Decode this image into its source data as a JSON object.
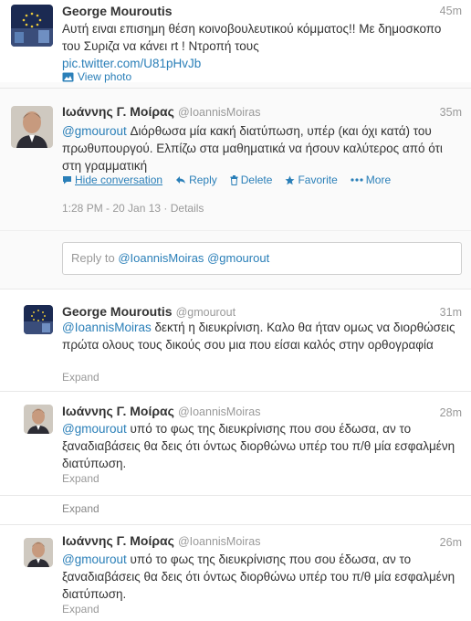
{
  "tweets": [
    {
      "name": "George Mouroutis",
      "handle": "",
      "time": "45m",
      "text": "Αυτή ειναι επισημη θέση κοινοβουλευτικού κόμματος!! Με δημοσκοπο του Συριζα να κάνει rt ! Ντροπή τους",
      "link": "pic.twitter.com/U81pHvJb",
      "view_photo": "View photo"
    },
    {
      "name": "Ιωάννης Γ. Μοίρας",
      "handle": "@IoannisMoiras",
      "time": "35m",
      "mention": "@gmourout",
      "text": " Διόρθωσα μία κακή διατύπωση, υπέρ (και όχι κατά) του πρωθυπουργού. Ελπίζω στα μαθηματικά να ήσουν καλύτερος από ότι στη γραμματική",
      "actions": {
        "hide": "Hide conversation",
        "reply": "Reply",
        "delete": "Delete",
        "favorite": "Favorite",
        "more": "More"
      },
      "timestamp": "1:28 PM - 20 Jan 13",
      "details": "Details"
    }
  ],
  "reply_box": {
    "prefix": "Reply to ",
    "mention1": "@IoannisMoiras",
    "mention2": "@gmourout"
  },
  "replies": [
    {
      "name": "George Mouroutis",
      "handle": "@gmourout",
      "time": "31m",
      "mention": "@IoannisMoiras",
      "text": " δεκτή η διευκρίνιση. Καλο θα ήταν ομως να διορθώσεις πρώτα ολους τους δικούς σου μια που είσαι καλός στην ορθογραφία",
      "expand": "Expand"
    },
    {
      "name": "Ιωάννης Γ. Μοίρας",
      "handle": "@IoannisMoiras",
      "time": "28m",
      "mention": "@gmourout",
      "text": " υπό το φως της διευκρίνισης που σου έδωσα, αν το ξαναδιαβάσεις θα δεις ότι όντως διορθώνω υπέρ του π/θ μία εσφαλμένη διατύπωση.",
      "expand": "Expand"
    },
    {
      "expand_only": "Expand"
    },
    {
      "name": "Ιωάννης Γ. Μοίρας",
      "handle": "@IoannisMoiras",
      "time": "26m",
      "mention": "@gmourout",
      "text": " υπό το φως της διευκρίνισης που σου έδωσα, αν το ξαναδιαβάσεις θα δεις ότι όντως διορθώνω υπέρ του π/θ μία εσφαλμένη διατύπωση.",
      "expand": "Expand"
    }
  ],
  "colors": {
    "link": "#2a7fb8",
    "muted": "#999999",
    "text": "#333333"
  }
}
